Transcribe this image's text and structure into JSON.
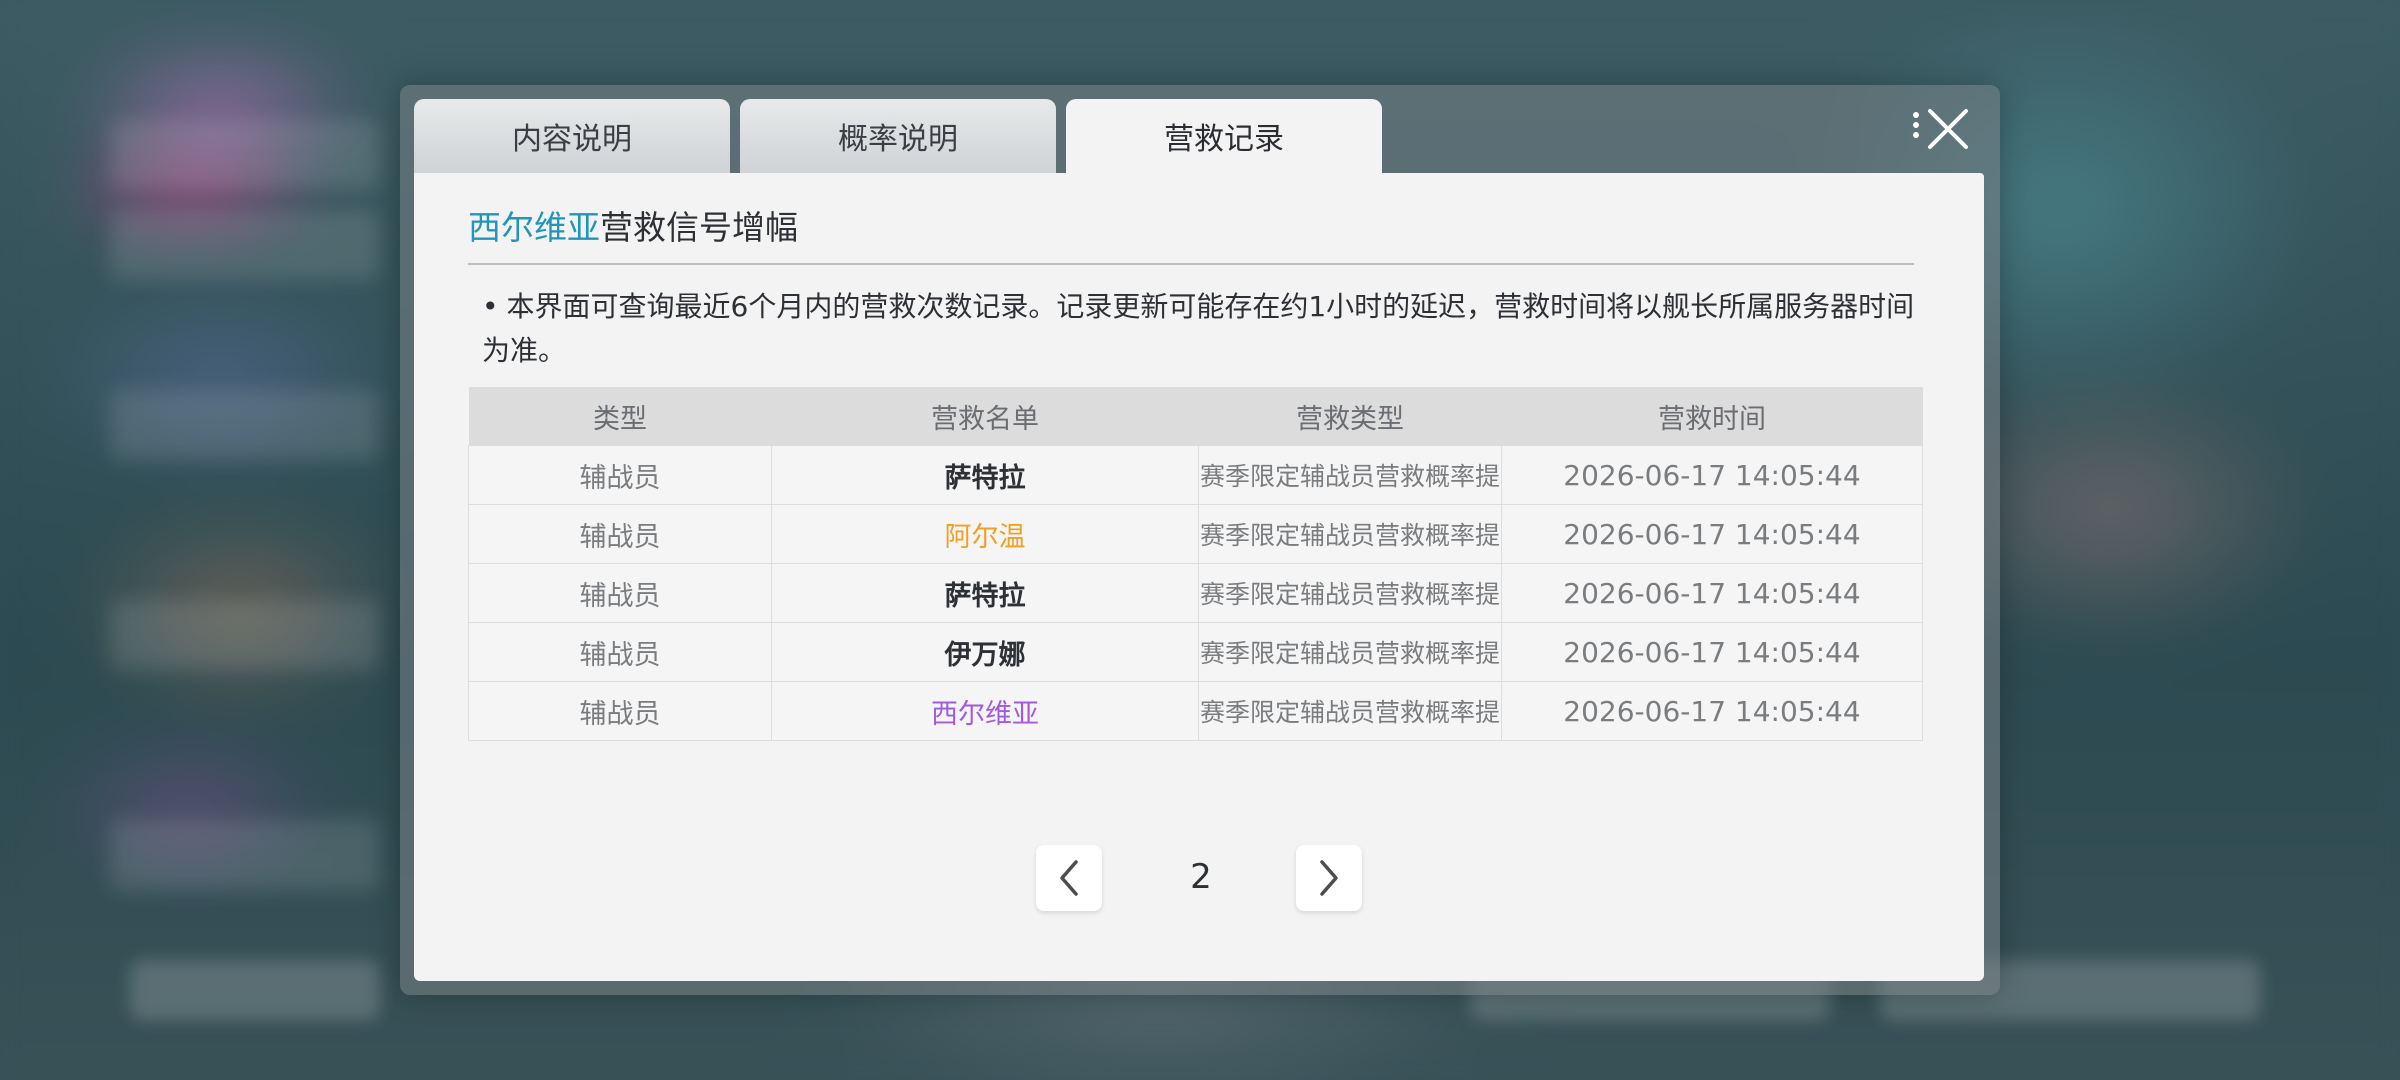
{
  "tabs": [
    {
      "label": "内容说明",
      "active": false
    },
    {
      "label": "概率说明",
      "active": false
    },
    {
      "label": "营救记录",
      "active": true
    }
  ],
  "panel": {
    "title_highlight": "西尔维亚",
    "title_rest": "营救信号增幅",
    "notice": "本界面可查询最近6个月内的营救次数记录。记录更新可能存在约1小时的延迟，营救时间将以舰长所属服务器时间为准。"
  },
  "table": {
    "headers": [
      "类型",
      "营救名单",
      "营救类型",
      "营救时间"
    ],
    "rows": [
      {
        "type": "辅战员",
        "name": "萨特拉",
        "rescue_type": "赛季限定辅战员营救概率提升",
        "time": "2026-06-17 14:05:44",
        "name_color": "#2d3035"
      },
      {
        "type": "辅战员",
        "name": "阿尔温",
        "rescue_type": "赛季限定辅战员营救概率提升",
        "time": "2026-06-17 14:05:44",
        "name_color": "#f2a024"
      },
      {
        "type": "辅战员",
        "name": "萨特拉",
        "rescue_type": "赛季限定辅战员营救概率提升",
        "time": "2026-06-17 14:05:44",
        "name_color": "#2d3035"
      },
      {
        "type": "辅战员",
        "name": "伊万娜",
        "rescue_type": "赛季限定辅战员营救概率提升",
        "time": "2026-06-17 14:05:44",
        "name_color": "#2d3035"
      },
      {
        "type": "辅战员",
        "name": "西尔维亚",
        "rescue_type": "赛季限定辅战员营救概率提升",
        "time": "2026-06-17 14:05:44",
        "name_color": "#a25ae0"
      }
    ]
  },
  "pager": {
    "current_page": "2",
    "prev_icon": "chevron-left-icon",
    "next_icon": "chevron-right-icon"
  },
  "close_icon": "close-icon",
  "colors": {
    "title_highlight": "#2196b9",
    "accent_orange": "#f2a024",
    "accent_purple": "#a25ae0"
  }
}
